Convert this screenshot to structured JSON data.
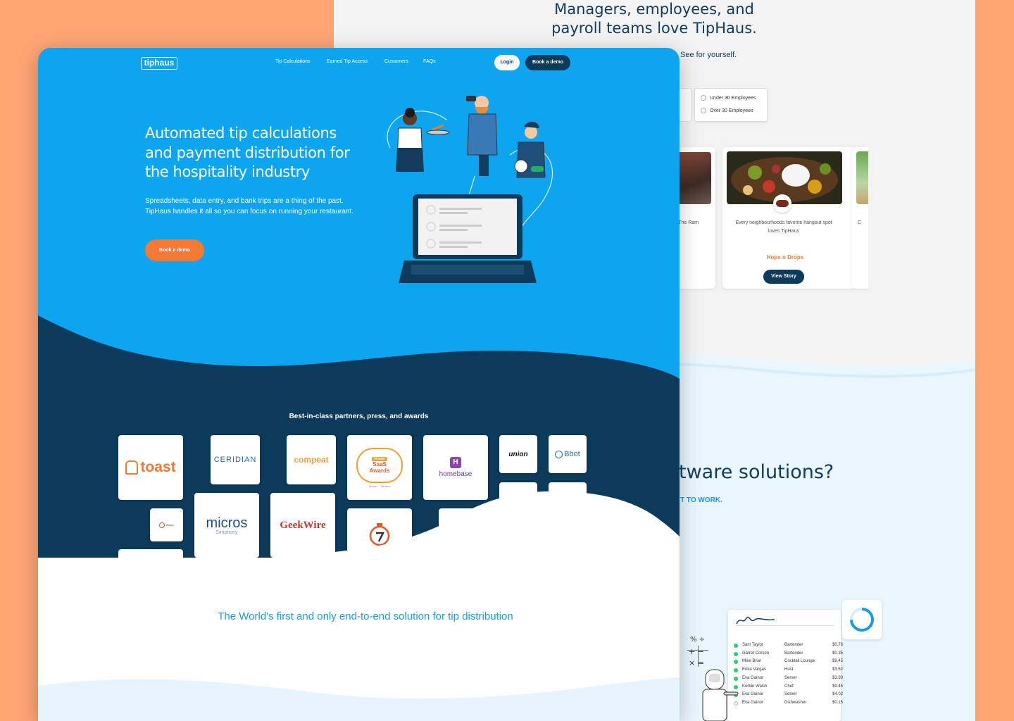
{
  "back": {
    "title": "Managers, employees, and payroll teams love TipHaus.",
    "see_yourself": "See for yourself.",
    "employee_options": [
      "Under 30 Employees",
      "Over 30 Employees"
    ],
    "story_left_text": "in The Ram",
    "story_center": {
      "text": "Every neighbourhoods favorite hangout spot loves TipHaus",
      "name": "Hops n Drops",
      "button": "View Story"
    },
    "story_right_text": "C",
    "section_heading": "tware solutions?",
    "section_link": "T TO WORK.",
    "tip_table": [
      {
        "name": "Sam Taylor",
        "role": "Bartender",
        "amount": "$0.76"
      },
      {
        "name": "Garret Corson",
        "role": "Bartender",
        "amount": "$0.35"
      },
      {
        "name": "Mike Briar",
        "role": "Cocktail Lounge",
        "amount": "$9.45"
      },
      {
        "name": "Erika Vargas",
        "role": "Host",
        "amount": "$3.62"
      },
      {
        "name": "Eva Gainor",
        "role": "Server",
        "amount": "$3.93"
      },
      {
        "name": "Korbin Walsh",
        "role": "Chef",
        "amount": "$9.45"
      },
      {
        "name": "Eva Gainor",
        "role": "Server",
        "amount": "$4.02"
      },
      {
        "name": "Eva Gainor",
        "role": "Dishwasher",
        "amount": "$0.15"
      }
    ]
  },
  "front": {
    "logo": "tiphaus",
    "nav": [
      "Tip Calculations",
      "Earned Tip Access",
      "Customers",
      "FAQs"
    ],
    "login": "Login",
    "book_demo": "Book a demo",
    "hero_title": "Automated tip calculations and payment distribution for the hospitality industry",
    "hero_desc": "Spreadsheets, data entry, and bank trips are a thing of the past. TipHaus handles it all so you can focus on running your restaurant.",
    "hero_button": "Book a demo",
    "partners_title": "Best-in-class partners, press, and awards",
    "partners": {
      "toast": "toast",
      "ceridian": "CERIDIAN",
      "compeat": "compeat",
      "saas_top": "Finalist",
      "saas_main": "SaaS Awards",
      "saas_sub": "Winner · TipHaus",
      "homebase_letter": "H",
      "homebase": "homebase",
      "union": "union",
      "bbot": "Bbot",
      "waiyin": "Waiyin",
      "micros": "micros",
      "micros_sub": "Simphony",
      "geekwire": "GeekWire"
    },
    "footer_text": "The World's first and only end-to-end solution for tip distribution"
  },
  "colors": {
    "background": "#FFA574",
    "hero_blue": "#0ea5f0",
    "navy": "#0b3a5a",
    "orange": "#f47a33"
  }
}
